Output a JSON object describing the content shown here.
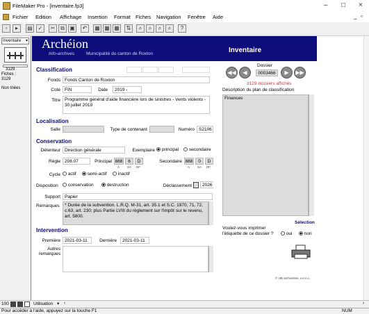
{
  "window": {
    "title": "FileMaker Pro - [inventaire.fp3]",
    "controls": [
      "–",
      "□",
      "×"
    ]
  },
  "menu": [
    "Fichier",
    "Edition",
    "Affichage",
    "Insertion",
    "Format",
    "Fiches",
    "Navigation",
    "Fenêtre",
    "Aide"
  ],
  "sidebar": {
    "layout_select": "Inventaire",
    "record_num": "3129",
    "fiches_label": "Fiches :",
    "fiches_count": "3129",
    "non_triees": "Non triées"
  },
  "header": {
    "logo": "Archéion",
    "tagline": "Info-archives",
    "municipality": "Municipalité du canton de Roxton",
    "title": "Inventaire"
  },
  "classification": {
    "section": "Classification",
    "fonds_label": "Fonds",
    "fonds_value": "Fonds Canton de Roxton",
    "cote_label": "Cote",
    "cote_value": "FIN",
    "date_label": "Date",
    "date_value": "2019 -",
    "titre_label": "Titre",
    "titre_value": "Programme général d'aide financière lors de sinistres - Vents violents - 30 juillet 2019"
  },
  "localisation": {
    "section": "Localisation",
    "salle_label": "Salle",
    "salle_value": "",
    "contenant_label": "Type de contenant",
    "contenant_value": "",
    "numero_label": "Numéro",
    "numero_value": "S2106"
  },
  "conservation": {
    "section": "Conservation",
    "detenteur_label": "Détenteur",
    "detenteur_value": "Direction générale",
    "exemplaire_label": "Exemplaire",
    "principal_opt": "principal",
    "secondaire_opt": "secondaire",
    "regle_label": "Règle",
    "regle_value": "208.07",
    "principal_label": "Principal",
    "principal_a": "888",
    "principal_sa": "6",
    "principal_df": "D",
    "secondaire_label": "Secondaire",
    "secondaire_a": "888",
    "secondaire_sa": "0",
    "secondaire_df": "D",
    "a_lbl": "A",
    "sa_lbl": "SA",
    "df_lbl": "DF",
    "cycle_label": "Cycle",
    "cycle_actif": "actif",
    "cycle_semi": "semi-actif",
    "cycle_inactif": "inactif",
    "disposition_label": "Disposition",
    "disp_conservation": "conservation",
    "disp_destruction": "destruction",
    "declassement_label": "Déclassement",
    "declassement_value": "2026",
    "support_label": "Support",
    "support_value": "Papier",
    "remarques_label": "Remarques",
    "remarques_value": "* Durée de la subvention. L.R.Q. M-31, art. 35.1 et S.C. 1970, 71, 72, c.63, art. 230; plus Partie LVIII du règlement sur l'impôt sur le revenu, art. 5800."
  },
  "intervention": {
    "section": "Intervention",
    "premiere_label": "Première",
    "premiere_value": "2021-03-11",
    "derniere_label": "Dernière",
    "derniere_value": "2021-03-11",
    "autres_label": "Autres remarques",
    "autres_value": ""
  },
  "right": {
    "dossier_label": "Dossier",
    "dossier_value": "0003466",
    "dossiers_affiches": "3129 dossiers affichés",
    "plan_label": "Description du plan de classification",
    "plan_value": "Finances",
    "selection": "Sélection",
    "imprimer_q": "Voulez-vous imprimer l'étiquette de ce dossier ?",
    "oui": "oui",
    "non": "non",
    "copyright": "© HB archivistes, s.e.n.c."
  },
  "bottom": {
    "zoom": "100",
    "mode": "Utilisation",
    "status": "Pour accéder à l'aide, appuyez sur la touche F1",
    "num": "NUM"
  },
  "colors": {
    "header_bg": "#0c0c7a",
    "section": "#0c0c7a",
    "field_gray": "#dcdcdc",
    "red_text": "#cc3333"
  }
}
